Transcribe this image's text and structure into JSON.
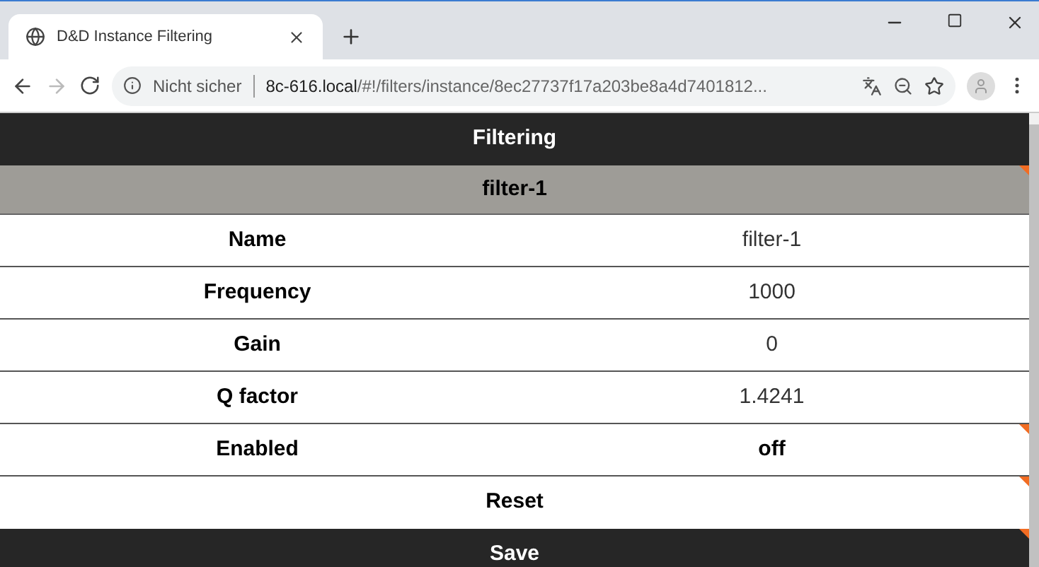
{
  "browser": {
    "tab_title": "D&D Instance Filtering",
    "security": "Nicht sicher",
    "url_host": "8c-616.local",
    "url_path": "/#!/filters/instance/8ec27737f17a203be8a4d7401812..."
  },
  "header": {
    "title": "Filtering"
  },
  "section": {
    "title": "filter-1",
    "flagged": true
  },
  "rows": [
    {
      "label": "Name",
      "value": "filter-1",
      "kind": "text",
      "flagged": false
    },
    {
      "label": "Frequency",
      "value": "1000",
      "kind": "text",
      "flagged": false
    },
    {
      "label": "Gain",
      "value": "0",
      "kind": "text",
      "flagged": false
    },
    {
      "label": "Q factor",
      "value": "1.4241",
      "kind": "text",
      "flagged": false
    },
    {
      "label": "Enabled",
      "value": "off",
      "kind": "toggle",
      "flagged": true
    }
  ],
  "actions": [
    {
      "label": "Reset",
      "kind": "light",
      "flagged": true
    },
    {
      "label": "Save",
      "kind": "dark",
      "flagged": true
    }
  ]
}
